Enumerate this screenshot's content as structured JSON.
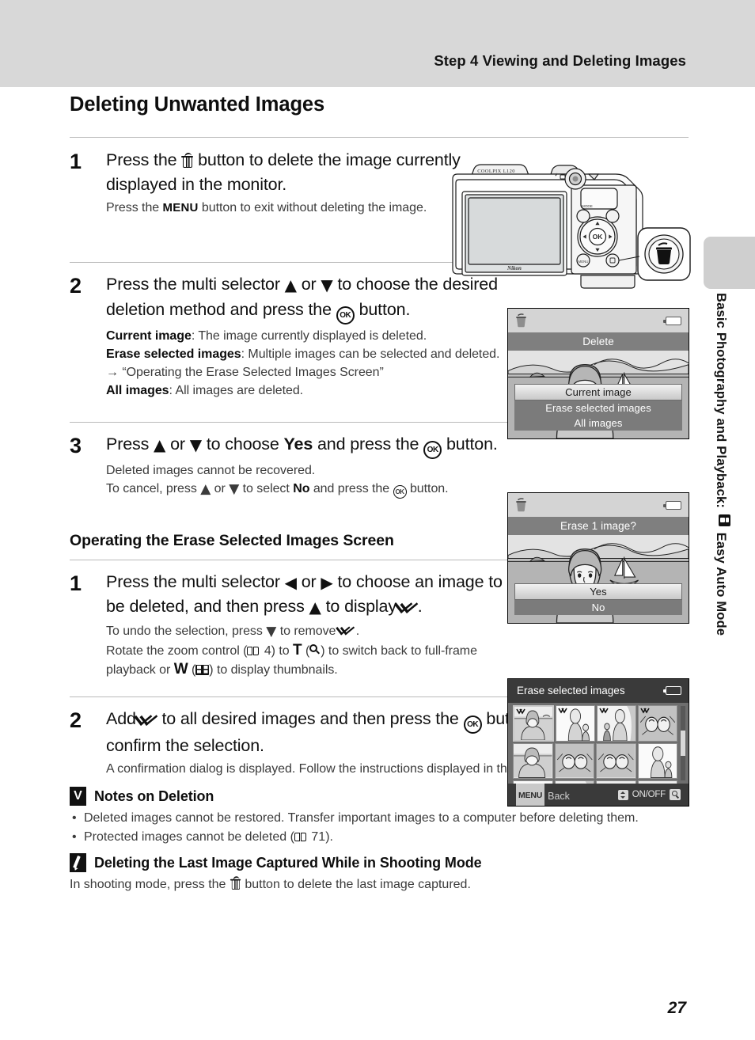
{
  "header": {
    "title": "Step 4 Viewing and Deleting Images"
  },
  "side_tab": {
    "text_before": "Basic Photography and Playback:",
    "icon": "easy-auto-mode-icon",
    "text_after": "Easy Auto Mode"
  },
  "page_heading": "Deleting Unwanted Images",
  "steps_main": [
    {
      "number": "1",
      "lead_a": "Press the",
      "lead_icon": "trash-icon",
      "lead_b": "button to delete the image currently displayed in the monitor.",
      "sub_a": "Press the",
      "sub_icon": "MENU",
      "sub_b": "button to exit without deleting the image."
    },
    {
      "number": "2",
      "lead_a": "Press the multi selector",
      "lead_up": "▲",
      "lead_or": "or",
      "lead_down": "▼",
      "lead_b": "to choose the desired deletion method and press the",
      "lead_ok": "OK",
      "lead_c": "button.",
      "details": [
        {
          "bold": "Current image",
          "rest": ": The image currently displayed is deleted."
        },
        {
          "bold": "Erase selected images",
          "rest": ": Multiple images can be selected and deleted."
        },
        {
          "arrow": "→",
          "quote": "“Operating the Erase Selected Images Screen”"
        },
        {
          "bold": "All images",
          "rest": ": All images are deleted."
        }
      ]
    },
    {
      "number": "3",
      "lead_a": "Press",
      "lead_up": "▲",
      "lead_or": "or",
      "lead_down": "▼",
      "lead_b": "to choose",
      "lead_yes": "Yes",
      "lead_c": "and press the",
      "lead_ok": "OK",
      "lead_d": "button.",
      "sub_line1": "Deleted images cannot be recovered.",
      "sub_line2_a": "To cancel, press",
      "sub_line2_b": "or",
      "sub_line2_c": "to select",
      "sub_line2_no": "No",
      "sub_line2_d": "and press the",
      "sub_line2_e": "button."
    }
  ],
  "sub_heading": "Operating the Erase Selected Images Screen",
  "steps_sub": [
    {
      "number": "1",
      "lead_a": "Press the multi selector",
      "lead_left": "◀",
      "lead_or": "or",
      "lead_right": "▶",
      "lead_b": "to choose an image to be deleted, and then press",
      "lead_up": "▲",
      "lead_c": "to display",
      "lead_check": "check-icon",
      "lead_d": ".",
      "sub_line1_a": "To undo the selection, press",
      "sub_line1_b": "to remove",
      "sub_line1_c": ".",
      "sub_line2_a": "Rotate the zoom control (",
      "sub_line2_page": "4",
      "sub_line2_b": ") to",
      "sub_line2_T": "T",
      "sub_line2_c": "(",
      "sub_line2_d": ") to switch back to full-frame playback or",
      "sub_line2_W": "W",
      "sub_line2_e": "(",
      "sub_line2_f": ") to display thumbnails."
    },
    {
      "number": "2",
      "lead_a": "Add",
      "lead_check": "check-icon",
      "lead_b": "to all desired images and then press the",
      "lead_ok": "OK",
      "lead_c": "button to confirm the selection.",
      "sub_line1": "A confirmation dialog is displayed. Follow the instructions displayed in the monitor."
    }
  ],
  "notes": [
    {
      "badge": "caution-v-icon",
      "title": "Notes on Deletion",
      "bullets": [
        "Deleted images cannot be restored. Transfer important images to a computer before deleting them.",
        "Protected images cannot be deleted (□ 71)."
      ],
      "bullet2_pre": "Protected images cannot be deleted (",
      "bullet2_page": "71",
      "bullet2_post": ")."
    },
    {
      "badge": "pencil-note-icon",
      "title": "Deleting the Last Image Captured While in Shooting Mode",
      "body_a": "In shooting mode, press the",
      "body_icon": "trash-icon",
      "body_b": "button to delete the last image captured."
    }
  ],
  "camera": {
    "model_label": "COOLPIX L120",
    "brand_label": "Nikon",
    "callout_icon": "trash-button-callout-icon",
    "buttons": {
      "mode": "MODE",
      "ok": "OK"
    }
  },
  "lcd_delete": {
    "title": "Delete",
    "options": [
      "Current image",
      "Erase selected images",
      "All images"
    ],
    "selected_index": 0,
    "status_icons": [
      "trash-icon",
      "battery-icon"
    ]
  },
  "lcd_erase1": {
    "title": "Erase 1 image?",
    "options": [
      "Yes",
      "No"
    ],
    "selected_index": 0,
    "status_icons": [
      "trash-icon",
      "battery-icon"
    ]
  },
  "lcd_grid": {
    "title": "Erase selected images",
    "footer_menu_chip": "MENU",
    "footer_back": "Back",
    "footer_onoff": "ON/OFF",
    "footer_icons": [
      "up-down-icon",
      "magnifier-icon",
      "battery-icon"
    ],
    "thumbnail_rows": 3,
    "thumbnail_cols": 4,
    "checked_thumbnails": [
      0,
      1,
      2,
      3
    ],
    "selected_thumbnail": 0
  },
  "page_number": "27",
  "colors": {
    "header_band": "#d8d8d8",
    "side_tab": "#cfcfcf",
    "rule": "#b9b9b9",
    "lcd_title_bar": "#7f7f7f",
    "lcd_option": "#7b7b7b",
    "grid_bar": "#3a3a3a",
    "grid_bg": "#6e6e6e"
  }
}
